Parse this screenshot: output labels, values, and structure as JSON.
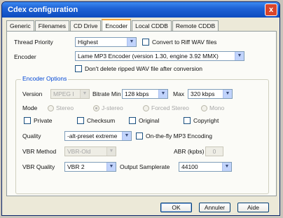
{
  "window": {
    "title": "Cdex configuration",
    "close_label": "x"
  },
  "tabs": [
    "Generic",
    "Filenames",
    "CD Drive",
    "Encoder",
    "Local CDDB",
    "Remote CDDB"
  ],
  "encoder": {
    "thread_priority_label": "Thread Priority",
    "thread_priority_value": "Highest",
    "convert_riff_label": "Convert to Riff WAV files",
    "encoder_label": "Encoder",
    "encoder_value": "Lame MP3 Encoder (version 1.30, engine 3.92 MMX)",
    "dont_delete_label": "Don't delete ripped WAV file after conversion"
  },
  "options": {
    "group_title": "Encoder Options",
    "version_label": "Version",
    "version_value": "MPEG I",
    "bitrate_min_label": "Bitrate Min",
    "bitrate_min_value": "128 kbps",
    "max_label": "Max",
    "max_value": "320 kbps",
    "mode_label": "Mode",
    "mode_stereo": "Stereo",
    "mode_jstereo": "J-stereo",
    "mode_forced": "Forced Stereo",
    "mode_mono": "Mono",
    "private_label": "Private",
    "checksum_label": "Checksum",
    "original_label": "Original",
    "copyright_label": "Copyright",
    "quality_label": "Quality",
    "quality_value": "-alt-preset extreme",
    "onthefly_label": "On-the-fly MP3 Encoding",
    "vbr_method_label": "VBR Method",
    "vbr_method_value": "VBR-Old",
    "abr_label": "ABR (kpbs)",
    "abr_value": "0",
    "vbr_quality_label": "VBR Quality",
    "vbr_quality_value": "VBR 2",
    "output_samplerate_label": "Output Samplerate",
    "output_samplerate_value": "44100"
  },
  "buttons": {
    "ok": "OK",
    "cancel": "Annuler",
    "help": "Aide"
  },
  "icons": {
    "dropdown": "chevron-down-icon",
    "close": "close-icon"
  }
}
